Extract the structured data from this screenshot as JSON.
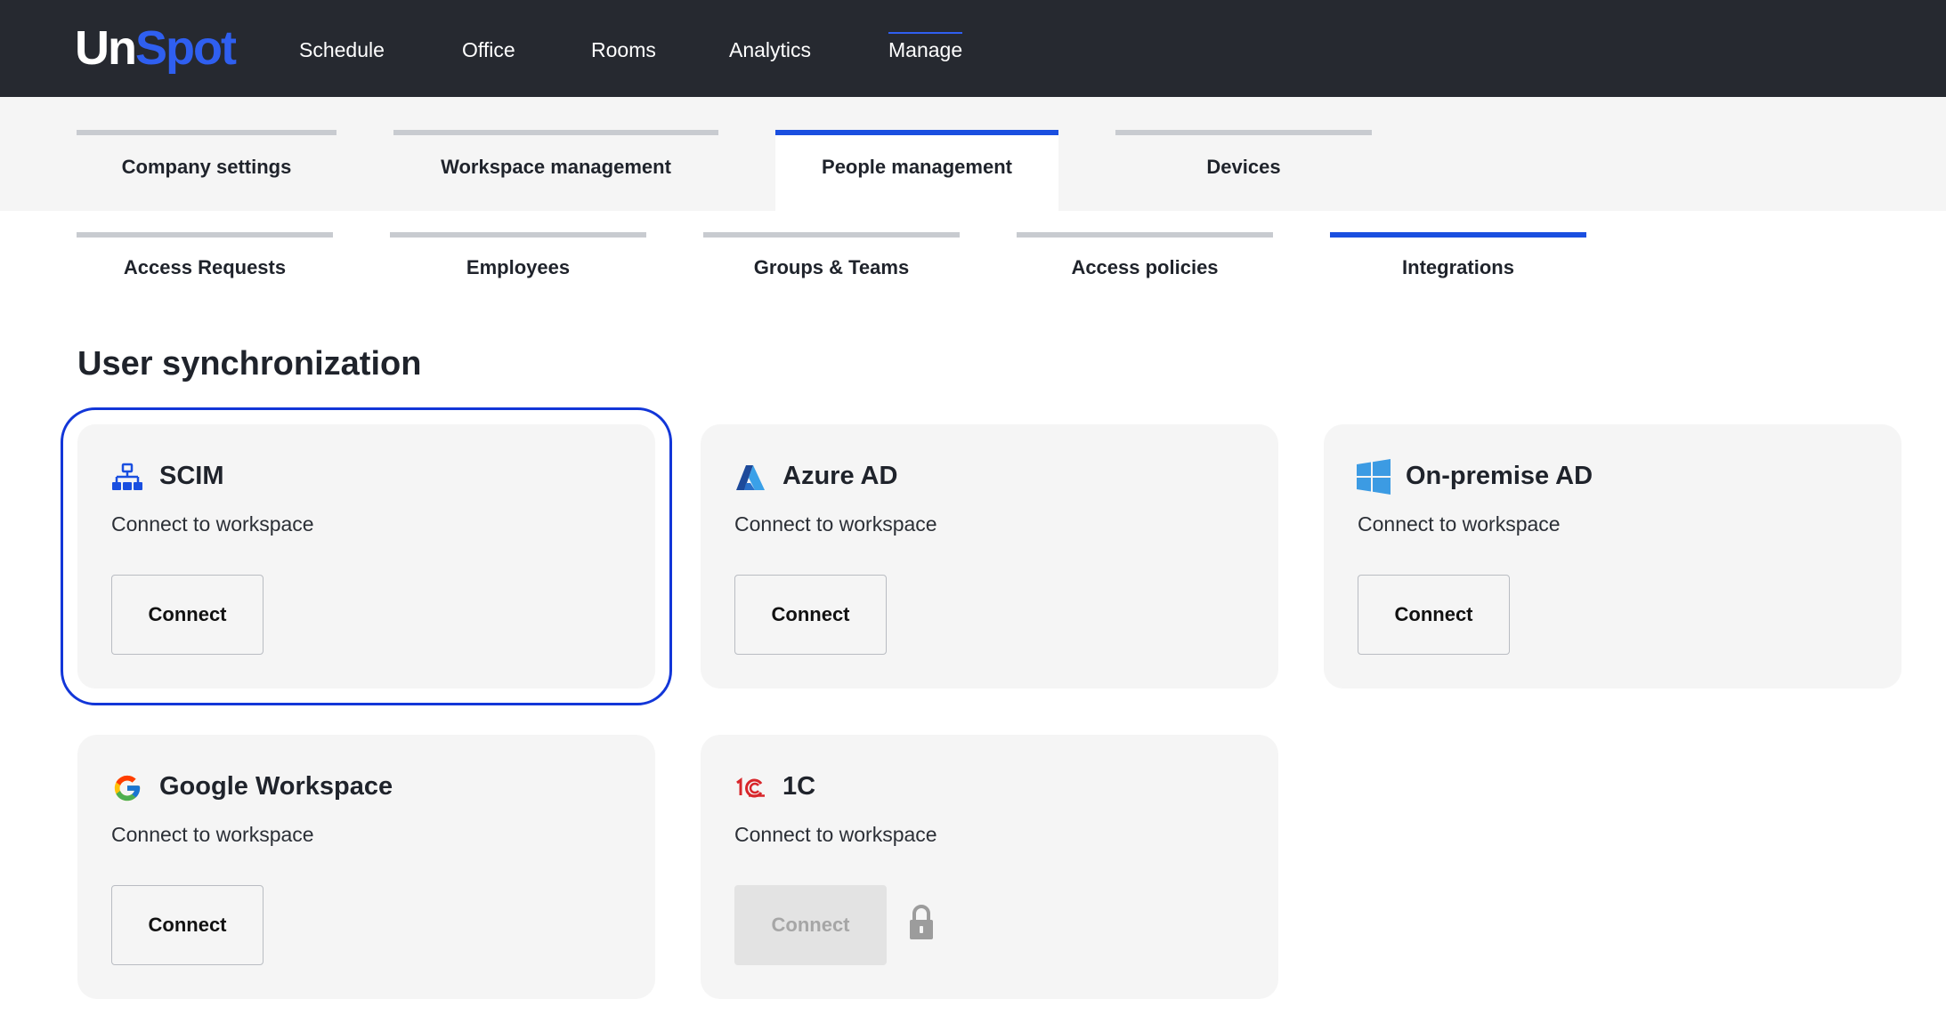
{
  "logo": {
    "part1": "Un",
    "part2": "Spot"
  },
  "topnav": [
    {
      "label": "Schedule"
    },
    {
      "label": "Office"
    },
    {
      "label": "Rooms"
    },
    {
      "label": "Analytics"
    },
    {
      "label": "Manage",
      "active": true
    }
  ],
  "tabs": [
    {
      "label": "Company settings"
    },
    {
      "label": "Workspace management"
    },
    {
      "label": "People management",
      "active": true
    },
    {
      "label": "Devices"
    }
  ],
  "subtabs": [
    {
      "label": "Access Requests"
    },
    {
      "label": "Employees"
    },
    {
      "label": "Groups & Teams"
    },
    {
      "label": "Access policies"
    },
    {
      "label": "Integrations",
      "active": true
    }
  ],
  "section": {
    "title": "User synchronization"
  },
  "cards": [
    {
      "title": "SCIM",
      "description": "Connect to workspace",
      "button": "Connect",
      "icon": "network-icon",
      "selected": true
    },
    {
      "title": "Azure AD",
      "description": "Connect to workspace",
      "button": "Connect",
      "icon": "azure-icon"
    },
    {
      "title": "On-premise AD",
      "description": "Connect to workspace",
      "button": "Connect",
      "icon": "windows-icon"
    },
    {
      "title": "Google Workspace",
      "description": "Connect to workspace",
      "button": "Connect",
      "icon": "google-icon"
    },
    {
      "title": "1C",
      "description": "Connect to workspace",
      "button": "Connect",
      "icon": "1c-icon",
      "disabled": true,
      "locked": true
    }
  ],
  "colors": {
    "accent": "#1a4fe0",
    "topbar": "#262930",
    "card": "#f5f5f5",
    "selection": "#1236d8"
  }
}
